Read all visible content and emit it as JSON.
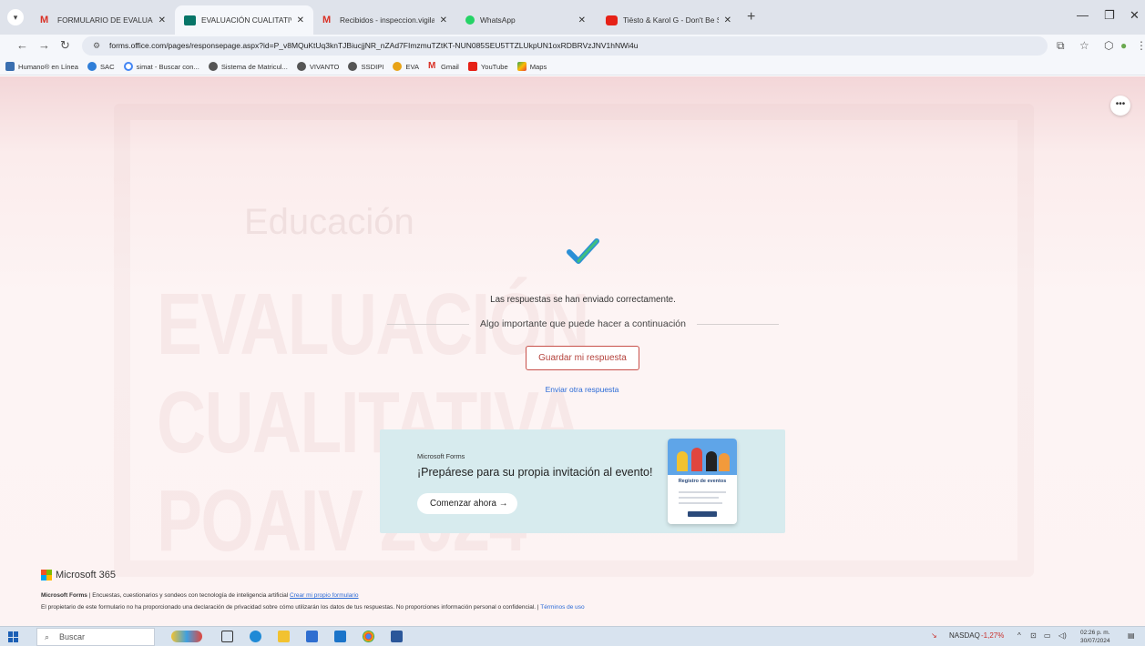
{
  "browser": {
    "tabs": [
      {
        "title": "FORMULARIO DE EVALUACIÓN",
        "icon": "gmail-icon"
      },
      {
        "title": "EVALUACIÓN CUALITATIVA POA",
        "icon": "forms-icon",
        "active": true
      },
      {
        "title": "Recibidos - inspeccion.vigilanc",
        "icon": "gmail-icon"
      },
      {
        "title": "WhatsApp",
        "icon": "whatsapp-icon"
      },
      {
        "title": "Tiësto & Karol G - Don't Be Shy",
        "icon": "youtube-icon"
      }
    ],
    "url": "forms.office.com/pages/responsepage.aspx?id=P_v8MQuKtUq3knTJBiucjjNR_nZAd7FImzmuTZtKT-NUN085SEU5TTZLUkpUN1oxRDBRVzJNV1hNWi4u",
    "bookmarks": [
      "Humano® en Línea",
      "SAC",
      "simat - Buscar con...",
      "Sistema de Matricul...",
      "VIVANTO",
      "SSDIPI",
      "EVA",
      "Gmail",
      "YouTube",
      "Maps"
    ]
  },
  "background": {
    "lines": [
      "EVALUACIÓN",
      "CUALITATIVA",
      "POAIV 2024"
    ],
    "subtitle": "Educación"
  },
  "confirmation": {
    "message": "Las respuestas se han enviado correctamente.",
    "next_heading": "Algo importante que puede hacer a continuación",
    "save_label": "Guardar mi respuesta",
    "another_label": "Enviar otra respuesta"
  },
  "promo": {
    "brand": "Microsoft Forms",
    "title": "¡Prepárese para su propia invitación al evento!",
    "button": "Comenzar ahora →",
    "art_title": "Registro de eventos"
  },
  "footer": {
    "brand": "Microsoft 365",
    "line1_bold": "Microsoft Forms",
    "line1_text": " | Encuestas, cuestionarios y sondeos con tecnología de inteligencia artificial ",
    "line1_link": "Crear mi propio formulario",
    "line2_text": "El propietario de este formulario no ha proporcionado una declaración de privacidad sobre cómo utilizarán los datos de tus respuestas. No proporciones información personal o confidencial. | ",
    "line2_link": "Términos de uso"
  },
  "taskbar": {
    "search_placeholder": "Buscar",
    "stock_name": "NASDAQ",
    "stock_change": "-1,27%",
    "time": "02:26 p. m.",
    "date": "30/07/2024"
  },
  "colors": {
    "accent_red": "#b4423c",
    "link_blue": "#2a6ad6",
    "promo_bg": "#d7ebee"
  }
}
